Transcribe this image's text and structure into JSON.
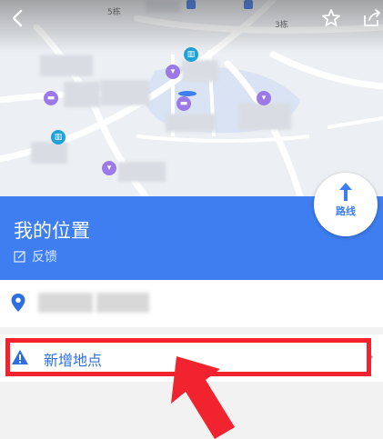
{
  "map": {
    "labels": [
      "5栋",
      "3栋"
    ],
    "back_icon": "chevron-left-icon",
    "favorite_icon": "star-outline-icon",
    "share_icon": "share-icon"
  },
  "location": {
    "title": "我的位置",
    "feedback_label": "反馈"
  },
  "route_button": {
    "label": "路线"
  },
  "add_place": {
    "label": "新增地点",
    "chevron": "›"
  },
  "colors": {
    "accent": "#3e7ef0",
    "highlight": "#f0232e",
    "poi_purple": "#9b79e6",
    "poi_teal": "#1fa2d8"
  }
}
